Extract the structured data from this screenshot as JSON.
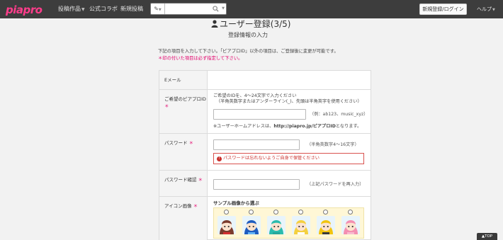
{
  "header": {
    "logo": "piapro",
    "nav": [
      {
        "label": "投稿作品",
        "has_caret": true
      },
      {
        "label": "公式コラボ",
        "has_caret": false
      },
      {
        "label": "新規投稿",
        "has_caret": false
      }
    ],
    "search": {
      "value": "",
      "placeholder": ""
    },
    "login_button": "新規登録/ログイン",
    "help": "ヘルプ"
  },
  "page": {
    "title": "ユーザー登録(3/5)",
    "subtitle": "登録情報の入力",
    "note": "下記の項目を入力して下さい。「ピアプロID」以外の項目は、ご登録後に変更が可能です。",
    "required_note": "＊印の付いた項目は必ず指定して下さい。"
  },
  "form": {
    "email": {
      "label": "Eメール",
      "value": ""
    },
    "piapro_id": {
      "label": "ご希望のピアプロID",
      "required": "＊",
      "instruction_1": "ご希望のIDを、4～24文字で入力ください",
      "instruction_2": "（半角英数字またはアンダーライン(_)、先頭は半角英字を使用ください）",
      "value": "",
      "example": "（例：ab123、music_xyz）",
      "url_note_prefix": "※ユーザーホームアドレスは、",
      "url_note_url": "http://piapro.jp/ピアプロID",
      "url_note_suffix": "となります。"
    },
    "password": {
      "label": "パスワード",
      "required": "＊",
      "value": "",
      "hint": "（半角英数字4～16文字）",
      "warning": "パスワードは忘れないようご自身で保管ください"
    },
    "password_confirm": {
      "label": "パスワード確認",
      "required": "＊",
      "value": "",
      "hint": "（上記パスワードを再入力）"
    },
    "icon": {
      "label": "アイコン画像",
      "required": "＊",
      "sample_title": "サンプル画像から選ぶ",
      "avatars": [
        {
          "name": "meiko",
          "hair": "#7a3b2e",
          "face": "#fde3cf",
          "accent": "#d32f2f"
        },
        {
          "name": "kaito",
          "hair": "#1d5bbf",
          "face": "#fde3cf",
          "accent": "#64b5f6"
        },
        {
          "name": "miku",
          "hair": "#2bbbad",
          "face": "#fde3cf",
          "accent": "#26a69a"
        },
        {
          "name": "rin",
          "hair": "#f4d03f",
          "face": "#fde3cf",
          "accent": "#ffffff"
        },
        {
          "name": "len",
          "hair": "#f1c40f",
          "face": "#fde3cf",
          "accent": "#3a3a3a"
        },
        {
          "name": "luka",
          "hair": "#f48fb1",
          "face": "#fde3cf",
          "accent": "#f8bbd0"
        }
      ]
    }
  },
  "totop": "▲TOP"
}
